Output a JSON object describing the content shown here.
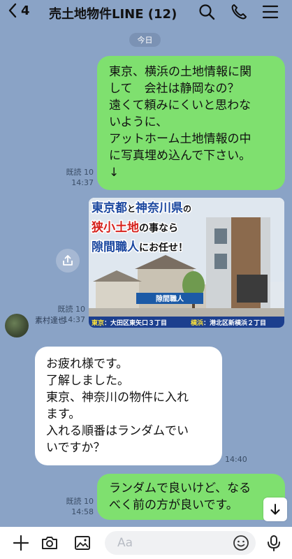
{
  "header": {
    "back_count": "4",
    "title": "売土地物件LINE (12)"
  },
  "date_label": "今日",
  "messages": {
    "m1": {
      "text": "東京、横浜の土地情報に関\nして　会社は静岡なの？\n遠くて頼みにくいと思わな\nいように、\nアットホーム土地情報の中\nに写真埋め込んで下さい。\n↓",
      "read": "既読 10",
      "time": "14:37"
    },
    "m2": {
      "read": "既読 10",
      "time": "14:37",
      "banner": {
        "line1_a": "東京都",
        "line1_b": "と",
        "line1_c": "神奈川県",
        "line1_d": "の",
        "line2_a": "狭小土地",
        "line2_b": "の事なら",
        "line3_a": "隙間職人",
        "line3_b": "にお任せ！",
        "sign": "隙間職人",
        "foot_left_tag": "東京",
        "foot_left": "：大田区東矢口３丁目",
        "foot_right_tag": "横浜",
        "foot_right": "：港北区新横浜２丁目"
      }
    },
    "m3": {
      "sender": "素村達也",
      "text": "お疲れ様です。\n了解しました。\n東京、神奈川の物件に入れ\nます。\n入れる順番はランダムでい\nいですか？",
      "time": "14:40"
    },
    "m4": {
      "text": "ランダムで良いけど、なる\nべく前の方が良いです。",
      "read": "既読 10",
      "time": "14:58"
    }
  },
  "input": {
    "placeholder": "Aa"
  },
  "colors": {
    "background": "#8aa3c6",
    "my_bubble": "#7fe06f",
    "their_bubble": "#ffffff"
  },
  "icons": [
    "chevron-left-icon",
    "search-icon",
    "phone-icon",
    "menu-icon",
    "share-icon",
    "arrow-down-icon",
    "plus-icon",
    "camera-icon",
    "image-icon",
    "emoji-icon",
    "microphone-icon"
  ]
}
